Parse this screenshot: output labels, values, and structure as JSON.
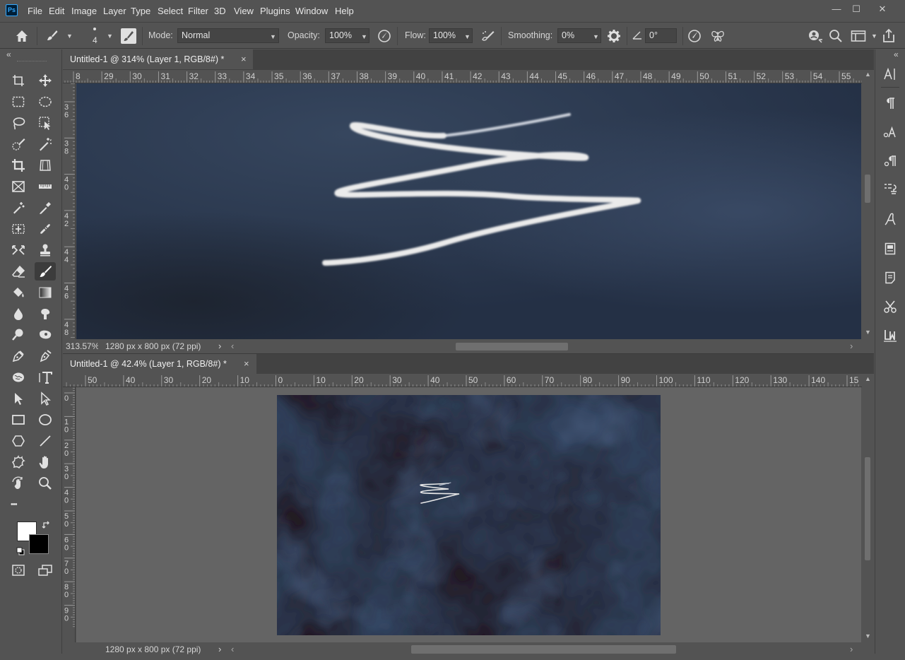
{
  "app": {
    "logo": "Ps"
  },
  "menu": [
    "File",
    "Edit",
    "Image",
    "Layer",
    "Type",
    "Select",
    "Filter",
    "3D",
    "View",
    "Plugins",
    "Window",
    "Help"
  ],
  "window_controls": {
    "minimize": "—",
    "maximize": "☐",
    "close": "✕"
  },
  "options": {
    "brush_size": "4",
    "mode_label": "Mode:",
    "mode_value": "Normal",
    "opacity_label": "Opacity:",
    "opacity_value": "100%",
    "flow_label": "Flow:",
    "flow_value": "100%",
    "smoothing_label": "Smoothing:",
    "smoothing_value": "0%",
    "angle_value": "0°"
  },
  "doc1": {
    "tab_title": "Untitled-1 @ 314% (Layer 1, RGB/8#) *",
    "close": "×",
    "zoom": "313.57%",
    "size_info": "1280 px x 800 px (72 ppi)",
    "hruler": [
      "8",
      "29",
      "30",
      "31",
      "32",
      "33",
      "34",
      "35",
      "36",
      "37",
      "38",
      "39",
      "40",
      "41",
      "42",
      "43",
      "44",
      "45",
      "46",
      "47",
      "48",
      "49",
      "50",
      "51",
      "52",
      "53",
      "54",
      "55"
    ],
    "vruler": [
      [
        "3",
        "6"
      ],
      [
        "3",
        "8"
      ],
      [
        "4",
        "0"
      ],
      [
        "4",
        "2"
      ],
      [
        "4",
        "4"
      ],
      [
        "4",
        "6"
      ],
      [
        "4",
        "8"
      ]
    ]
  },
  "doc2": {
    "tab_title": "Untitled-1 @ 42.4% (Layer 1, RGB/8#) *",
    "close": "×",
    "size_info": "1280 px x 800 px (72 ppi)",
    "hruler": [
      "50",
      "40",
      "30",
      "20",
      "10",
      "0",
      "10",
      "20",
      "30",
      "40",
      "50",
      "60",
      "70",
      "80",
      "90",
      "100",
      "110",
      "120",
      "130",
      "140",
      "15"
    ],
    "vruler": [
      [
        "0"
      ],
      [
        "1",
        "0"
      ],
      [
        "2",
        "0"
      ],
      [
        "3",
        "0"
      ],
      [
        "4",
        "0"
      ],
      [
        "5",
        "0"
      ],
      [
        "6",
        "0"
      ],
      [
        "7",
        "0"
      ],
      [
        "8",
        "0"
      ],
      [
        "9",
        "0"
      ]
    ]
  },
  "icons": {
    "arrow": "›",
    "arrow_left": "‹",
    "collapse": "«",
    "collapse_right": "«",
    "dots": "•••"
  },
  "colors": {
    "foreground": "#ffffff",
    "background": "#000000",
    "canvas_bg": "#646464"
  }
}
